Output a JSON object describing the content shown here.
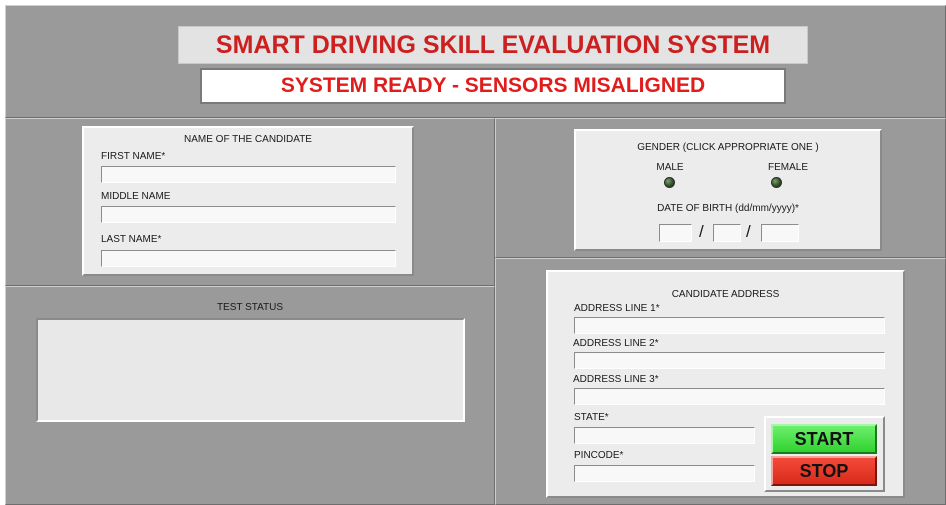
{
  "header": {
    "title": "SMART DRIVING SKILL EVALUATION SYSTEM",
    "status": "SYSTEM READY - SENSORS MISALIGNED"
  },
  "name_section": {
    "heading": "NAME OF THE CANDIDATE",
    "first_name_label": "FIRST NAME*",
    "first_name_value": "",
    "middle_name_label": "MIDDLE NAME",
    "middle_name_value": "",
    "last_name_label": "LAST NAME*",
    "last_name_value": ""
  },
  "gender_section": {
    "heading": "GENDER (CLICK APPROPRIATE ONE )",
    "male_label": "MALE",
    "female_label": "FEMALE",
    "male_selected": false,
    "female_selected": false,
    "dob_label": "DATE OF BIRTH (dd/mm/yyyy)*",
    "dob_separator": "/",
    "dob_day": "",
    "dob_month": "",
    "dob_year": ""
  },
  "test_status": {
    "heading": "TEST STATUS",
    "text": ""
  },
  "address_section": {
    "heading": "CANDIDATE ADDRESS",
    "line1_label": "ADDRESS LINE 1*",
    "line1_value": "",
    "line2_label": "ADDRESS LINE 2*",
    "line2_value": "",
    "line3_label": "ADDRESS LINE 3*",
    "line3_value": "",
    "state_label": "STATE*",
    "state_value": "",
    "pincode_label": "PINCODE*",
    "pincode_value": ""
  },
  "controls": {
    "start_label": "START",
    "stop_label": "STOP",
    "start_color": "#3fe03f",
    "stop_color": "#e8301f"
  },
  "colors": {
    "title_text": "#cc1f1f",
    "status_text": "#e01c1c",
    "background": "#9e9e9e",
    "led_off": "#33502a"
  }
}
